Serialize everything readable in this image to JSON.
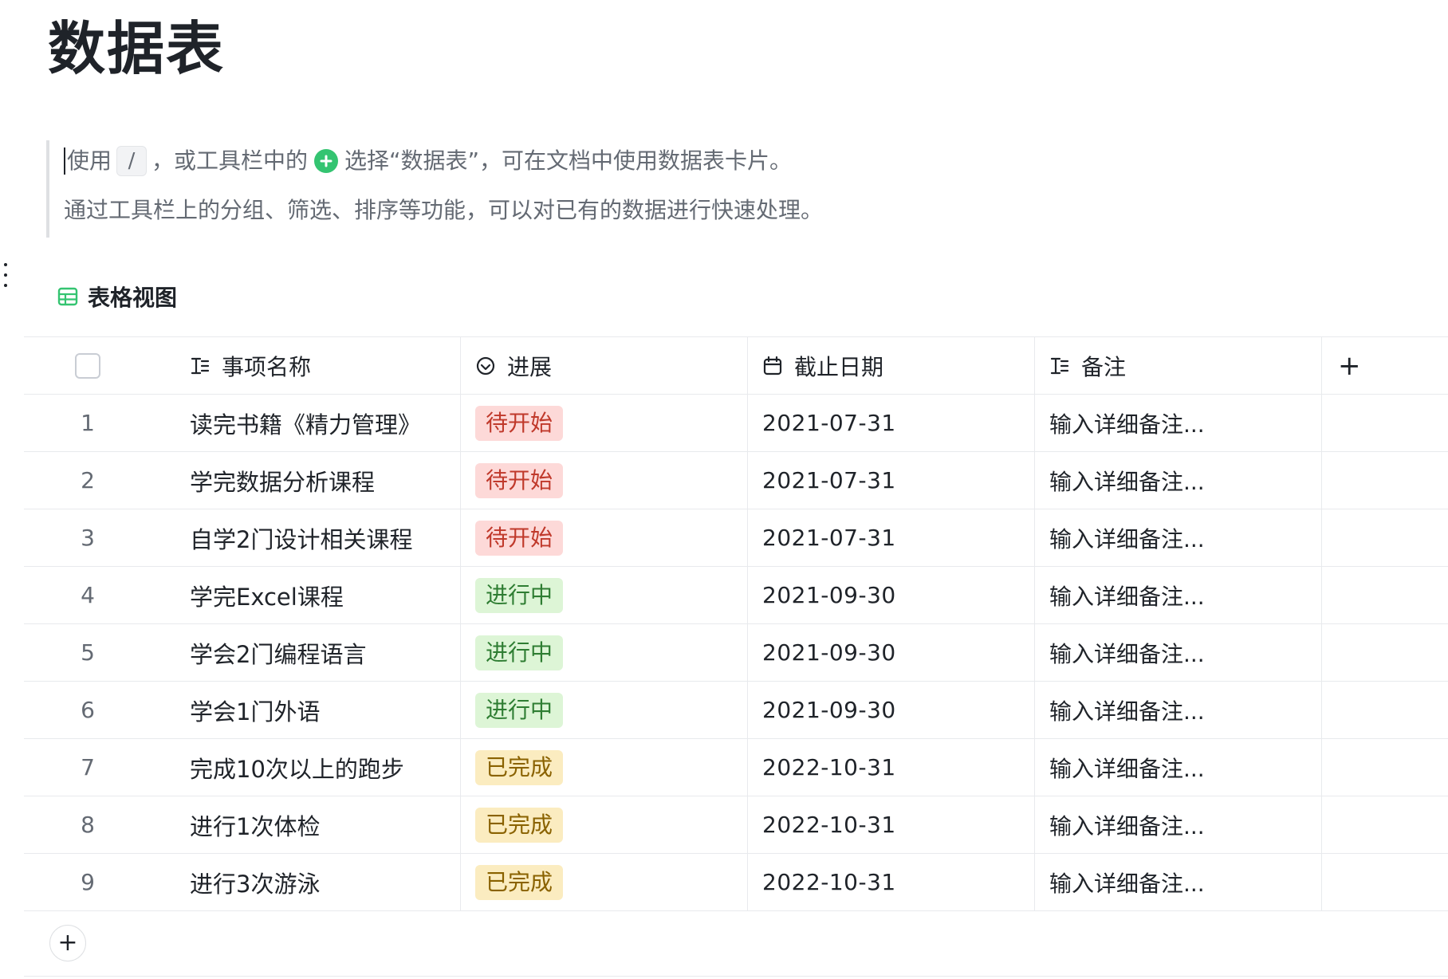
{
  "document": {
    "title": "数据表"
  },
  "callout": {
    "line1_part1": "使用",
    "line1_key": "/",
    "line1_part2": "，或工具栏中的",
    "line1_part3": "选择“数据表”，可在文档中使用数据表卡片。",
    "line2": "通过工具栏上的分组、筛选、排序等功能，可以对已有的数据进行快速处理。"
  },
  "view": {
    "label": "表格视图"
  },
  "columns": {
    "name": "事项名称",
    "progress": "进展",
    "date": "截止日期",
    "note": "备注",
    "add": "+"
  },
  "rows": [
    {
      "index": "1",
      "name": "读完书籍《精力管理》",
      "status": "待开始",
      "date": "2021-07-31",
      "note": "输入详细备注..."
    },
    {
      "index": "2",
      "name": "学完数据分析课程",
      "status": "待开始",
      "date": "2021-07-31",
      "note": "输入详细备注..."
    },
    {
      "index": "3",
      "name": "自学2门设计相关课程",
      "status": "待开始",
      "date": "2021-07-31",
      "note": "输入详细备注..."
    },
    {
      "index": "4",
      "name": "学完Excel课程",
      "status": "进行中",
      "date": "2021-09-30",
      "note": "输入详细备注..."
    },
    {
      "index": "5",
      "name": "学会2门编程语言",
      "status": "进行中",
      "date": "2021-09-30",
      "note": "输入详细备注..."
    },
    {
      "index": "6",
      "name": "学会1门外语",
      "status": "进行中",
      "date": "2021-09-30",
      "note": "输入详细备注..."
    },
    {
      "index": "7",
      "name": "完成10次以上的跑步",
      "status": "已完成",
      "date": "2022-10-31",
      "note": "输入详细备注..."
    },
    {
      "index": "8",
      "name": "进行1次体检",
      "status": "已完成",
      "date": "2022-10-31",
      "note": "输入详细备注..."
    },
    {
      "index": "9",
      "name": "进行3次游泳",
      "status": "已完成",
      "date": "2022-10-31",
      "note": "输入详细备注..."
    }
  ],
  "status_colors": {
    "待开始": {
      "bg": "#fdd9d8",
      "fg": "#c0392b"
    },
    "进行中": {
      "bg": "#ddf5d6",
      "fg": "#2e7d32"
    },
    "已完成": {
      "bg": "#fbecc0",
      "fg": "#8a6200"
    }
  },
  "add_row": {
    "label": "+"
  },
  "icons": {
    "callout_insert": "plus-circle-icon",
    "view": "table-grid-icon",
    "name_column": "text-icon",
    "progress_column": "status-circle-icon",
    "date_column": "calendar-icon",
    "note_column": "text-icon",
    "side_menu": "more-vertical-icon"
  },
  "accent_color": "#34c471"
}
